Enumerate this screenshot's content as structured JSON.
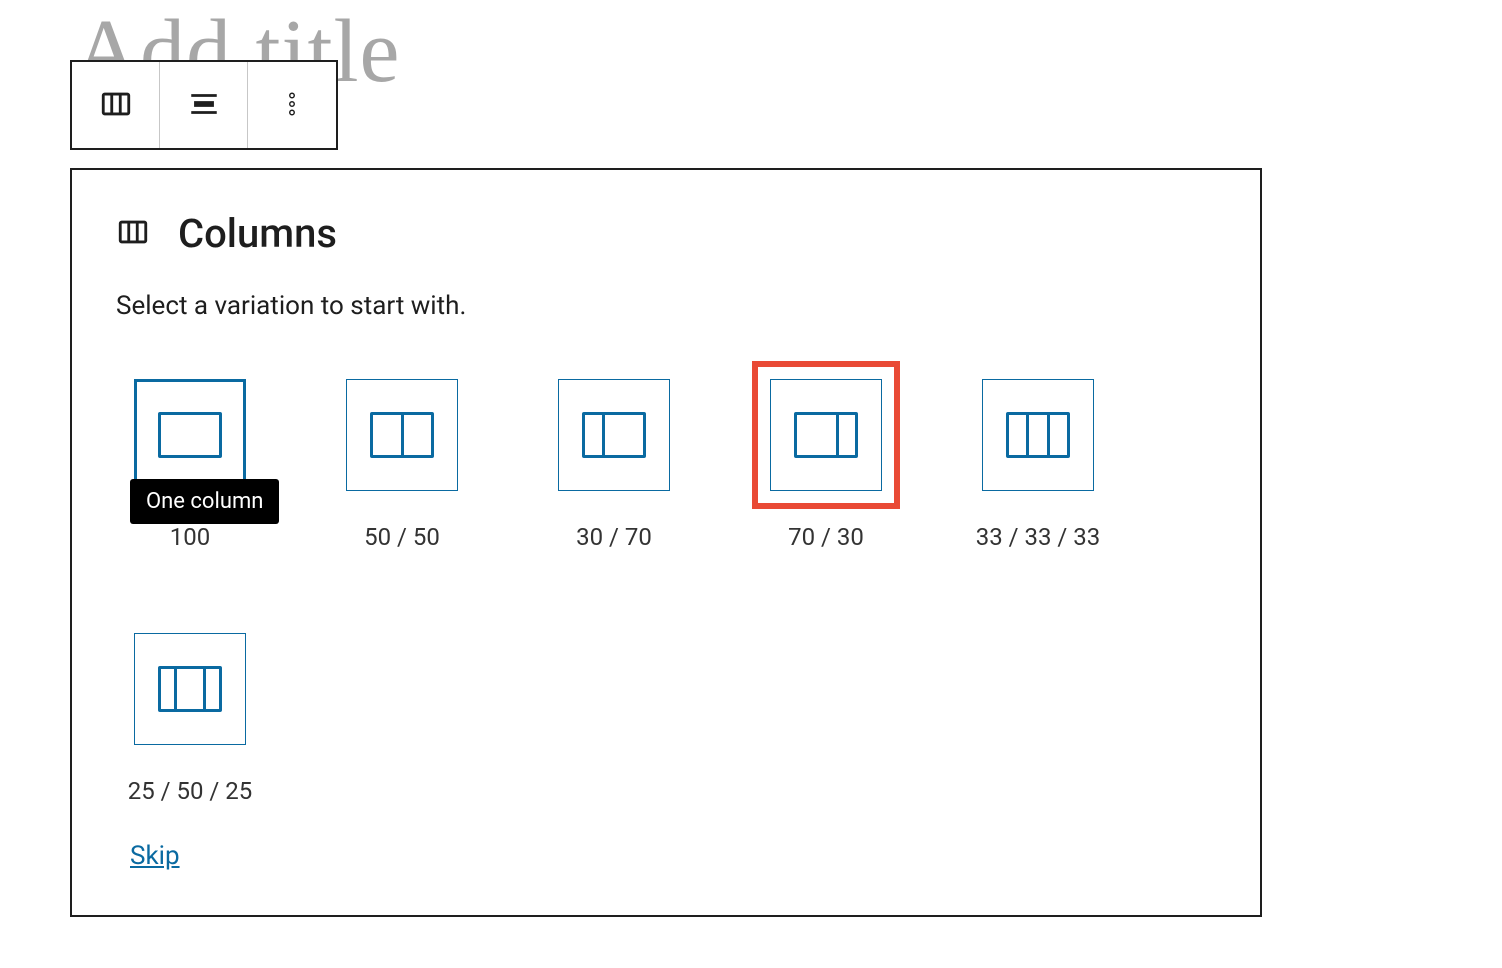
{
  "page": {
    "title_placeholder": "Add title"
  },
  "toolbar": {
    "block_type": "columns",
    "align": "align-center",
    "more": "more-options"
  },
  "panel": {
    "title": "Columns",
    "instruction": "Select a variation to start with.",
    "skip_label": "Skip",
    "tooltip_text": "One column",
    "variations": [
      {
        "id": "100",
        "label": "100",
        "cols": [
          100
        ],
        "selected": true,
        "highlighted": false,
        "tooltip": true
      },
      {
        "id": "50-50",
        "label": "50 / 50",
        "cols": [
          50,
          50
        ],
        "selected": false,
        "highlighted": false
      },
      {
        "id": "30-70",
        "label": "30 / 70",
        "cols": [
          30,
          70
        ],
        "selected": false,
        "highlighted": false
      },
      {
        "id": "70-30",
        "label": "70 / 30",
        "cols": [
          70,
          30
        ],
        "selected": false,
        "highlighted": true
      },
      {
        "id": "33-33-33",
        "label": "33 / 33 / 33",
        "cols": [
          33,
          33,
          33
        ],
        "selected": false,
        "highlighted": false
      },
      {
        "id": "25-50-25",
        "label": "25 / 50 / 25",
        "cols": [
          25,
          50,
          25
        ],
        "selected": false,
        "highlighted": false
      }
    ]
  }
}
